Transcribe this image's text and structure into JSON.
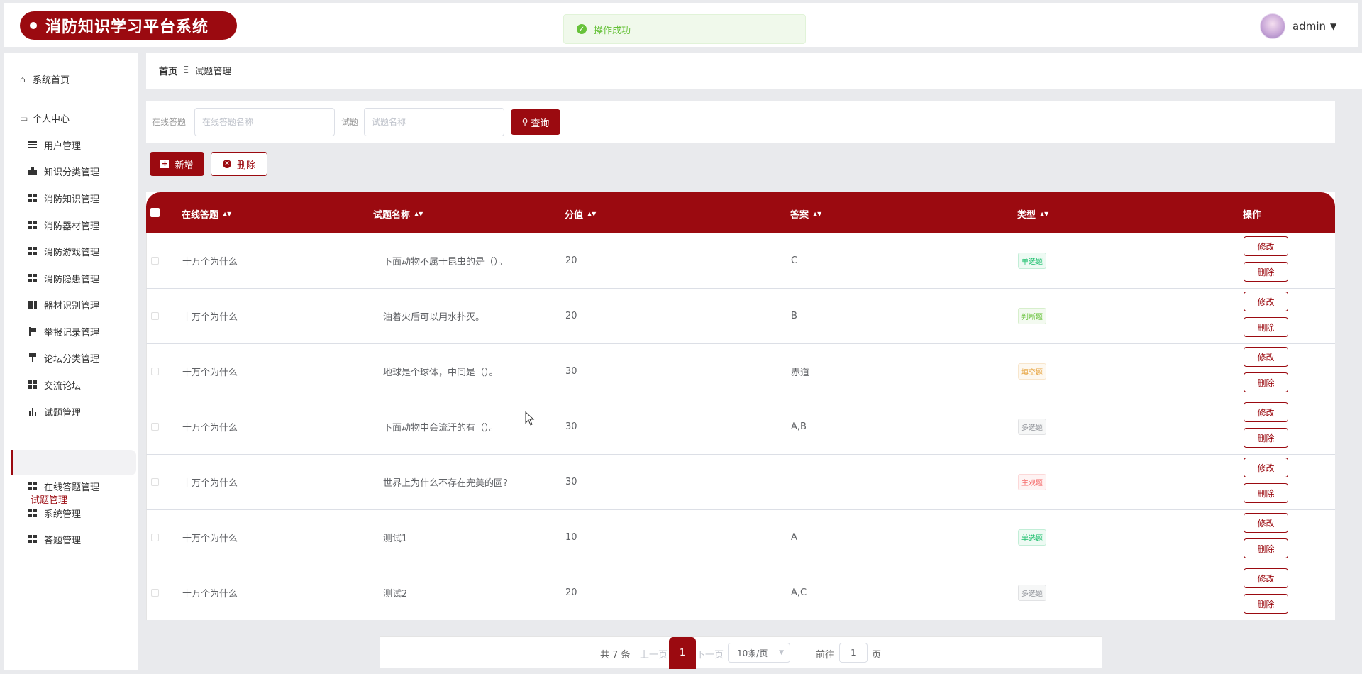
{
  "app": {
    "title": "消防知识学习平台系统",
    "toast": "操作成功",
    "username": "admin",
    "accent_color": "#9b0a10"
  },
  "sidebar": {
    "home": "系统首页",
    "personal": "个人中心",
    "items": [
      {
        "label": "用户管理",
        "icon": "list-icon"
      },
      {
        "label": "知识分类管理",
        "icon": "briefcase-icon"
      },
      {
        "label": "消防知识管理",
        "icon": "grid-icon"
      },
      {
        "label": "消防器材管理",
        "icon": "grid-icon"
      },
      {
        "label": "消防游戏管理",
        "icon": "grid-icon"
      },
      {
        "label": "消防隐患管理",
        "icon": "grid-icon"
      },
      {
        "label": "器材识别管理",
        "icon": "books-icon"
      },
      {
        "label": "举报记录管理",
        "icon": "flag-icon"
      },
      {
        "label": "论坛分类管理",
        "icon": "pin-icon"
      },
      {
        "label": "交流论坛",
        "icon": "grid-icon"
      },
      {
        "label": "试题管理",
        "icon": "bar-chart-icon"
      }
    ],
    "active_sub": "试题管理",
    "items_after": [
      {
        "label": "在线答题管理",
        "icon": "grid-icon"
      },
      {
        "label": "系统管理",
        "icon": "grid-icon"
      },
      {
        "label": "答题管理",
        "icon": "grid-icon"
      }
    ]
  },
  "breadcrumb": {
    "home": "首页",
    "separator": "Ξ",
    "current": "试题管理"
  },
  "search": {
    "label1": "在线答题",
    "placeholder1": "在线答题名称",
    "label2": "试题",
    "placeholder2": "试题名称",
    "button": "查询"
  },
  "actions": {
    "add": "新增",
    "delete": "删除"
  },
  "table": {
    "headers": [
      "在线答题",
      "试题名称",
      "分值",
      "答案",
      "类型",
      "操作"
    ],
    "edit_label": "修改",
    "delete_label": "删除",
    "rows": [
      {
        "quiz": "十万个为什么",
        "question": "下面动物不属于昆虫的是（）。",
        "score": "20",
        "answer": "C",
        "type": "单选题",
        "type_color": "#19be6b"
      },
      {
        "quiz": "十万个为什么",
        "question": "油着火后可以用水扑灭。",
        "score": "20",
        "answer": "B",
        "type": "判断题",
        "type_color": "#67c23a"
      },
      {
        "quiz": "十万个为什么",
        "question": "地球是个球体，中间是（）。",
        "score": "30",
        "answer": "赤道",
        "type": "填空题",
        "type_color": "#e6a23c"
      },
      {
        "quiz": "十万个为什么",
        "question": "下面动物中会流汗的有（）。",
        "score": "30",
        "answer": "A,B",
        "type": "多选题",
        "type_color": "#909399"
      },
      {
        "quiz": "十万个为什么",
        "question": "世界上为什么不存在完美的圆?",
        "score": "30",
        "answer": "",
        "type": "主观题",
        "type_color": "#f56c6c"
      },
      {
        "quiz": "十万个为什么",
        "question": "测试1",
        "score": "10",
        "answer": "A",
        "type": "单选题",
        "type_color": "#19be6b"
      },
      {
        "quiz": "十万个为什么",
        "question": "测试2",
        "score": "20",
        "answer": "A,C",
        "type": "多选题",
        "type_color": "#909399"
      }
    ]
  },
  "pagination": {
    "total": "共 7 条",
    "prev": "上一页",
    "current": "1",
    "next": "下一页",
    "page_size": "10条/页",
    "goto_label": "前往",
    "goto_value": "1",
    "page_unit": "页"
  }
}
